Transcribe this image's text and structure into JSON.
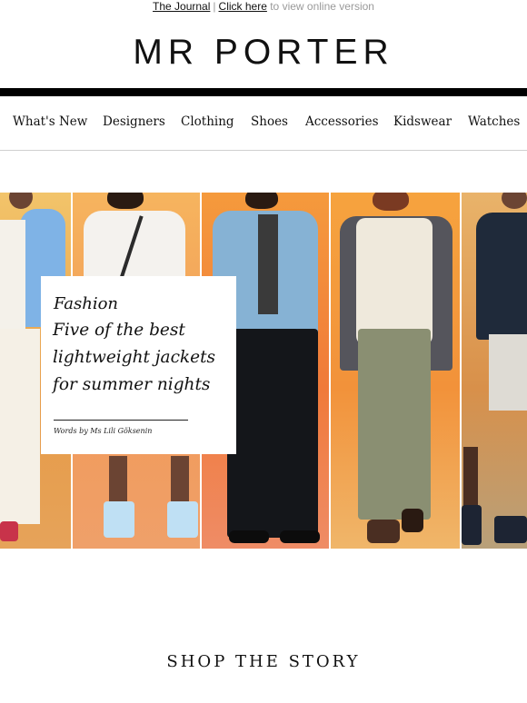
{
  "topbar": {
    "journal_link": "The Journal",
    "separator": "|",
    "click_link": "Click here",
    "suffix": " to view online version"
  },
  "brand": {
    "logo": "MR PORTER"
  },
  "nav": {
    "items": [
      "What's New",
      "Designers",
      "Clothing",
      "Shoes",
      "Accessories",
      "Kidswear",
      "Watches"
    ]
  },
  "hero": {
    "kicker": "Fashion",
    "title": "Five of the best lightweight jackets for summer nights",
    "byline": "Words by Ms Lili Göksenin"
  },
  "section": {
    "heading": "SHOP THE STORY"
  },
  "colors": {
    "panel1_bg": "#e9a24a",
    "panel2_bg": "#f0a85c",
    "panel3_bg": "#f08a3e",
    "panel4_bg": "#f39a3a",
    "panel5_bg": "#d98a40"
  }
}
